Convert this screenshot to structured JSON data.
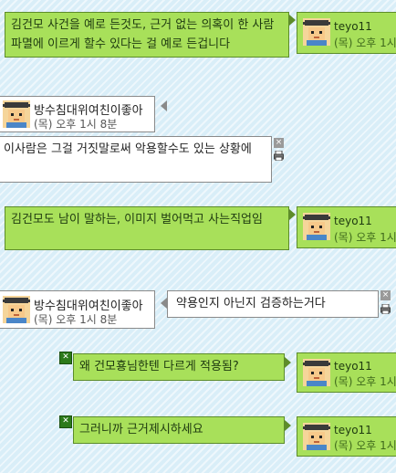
{
  "messages": [
    {
      "text": "김건모 사건을 예로 든것도, 근거 없는 의혹이 한 사람 파멸에 이르게 할수 있다는 걸 예로 든겁니다"
    },
    {
      "text": "이사람은 그걸 거짓말로써 악용할수도 있는 상황에"
    },
    {
      "text": "김건모도 남이 말하는, 이미지 벌어먹고 사는직업임"
    },
    {
      "text": "약용인지 아닌지 검증하는거다"
    },
    {
      "text": "왜 건모횽님한텐 다르게 적용됨?"
    },
    {
      "text": "그러니까 근거제시하세요"
    }
  ],
  "senders": {
    "teyo": {
      "name": "teyo11",
      "time": "(목) 오후 1시"
    },
    "other": {
      "name": "방수침대위여친이좋아",
      "time": "(목) 오후 1시 8분"
    }
  },
  "colors": {
    "my_bubble": "#a8e05a",
    "my_bubble_border": "#5d8c2a",
    "their_bubble": "#ffffff",
    "background": "#d9eef8"
  },
  "icons": {
    "close": "×",
    "check": "✕",
    "print": "printer-icon",
    "scroll_left": "◂"
  }
}
